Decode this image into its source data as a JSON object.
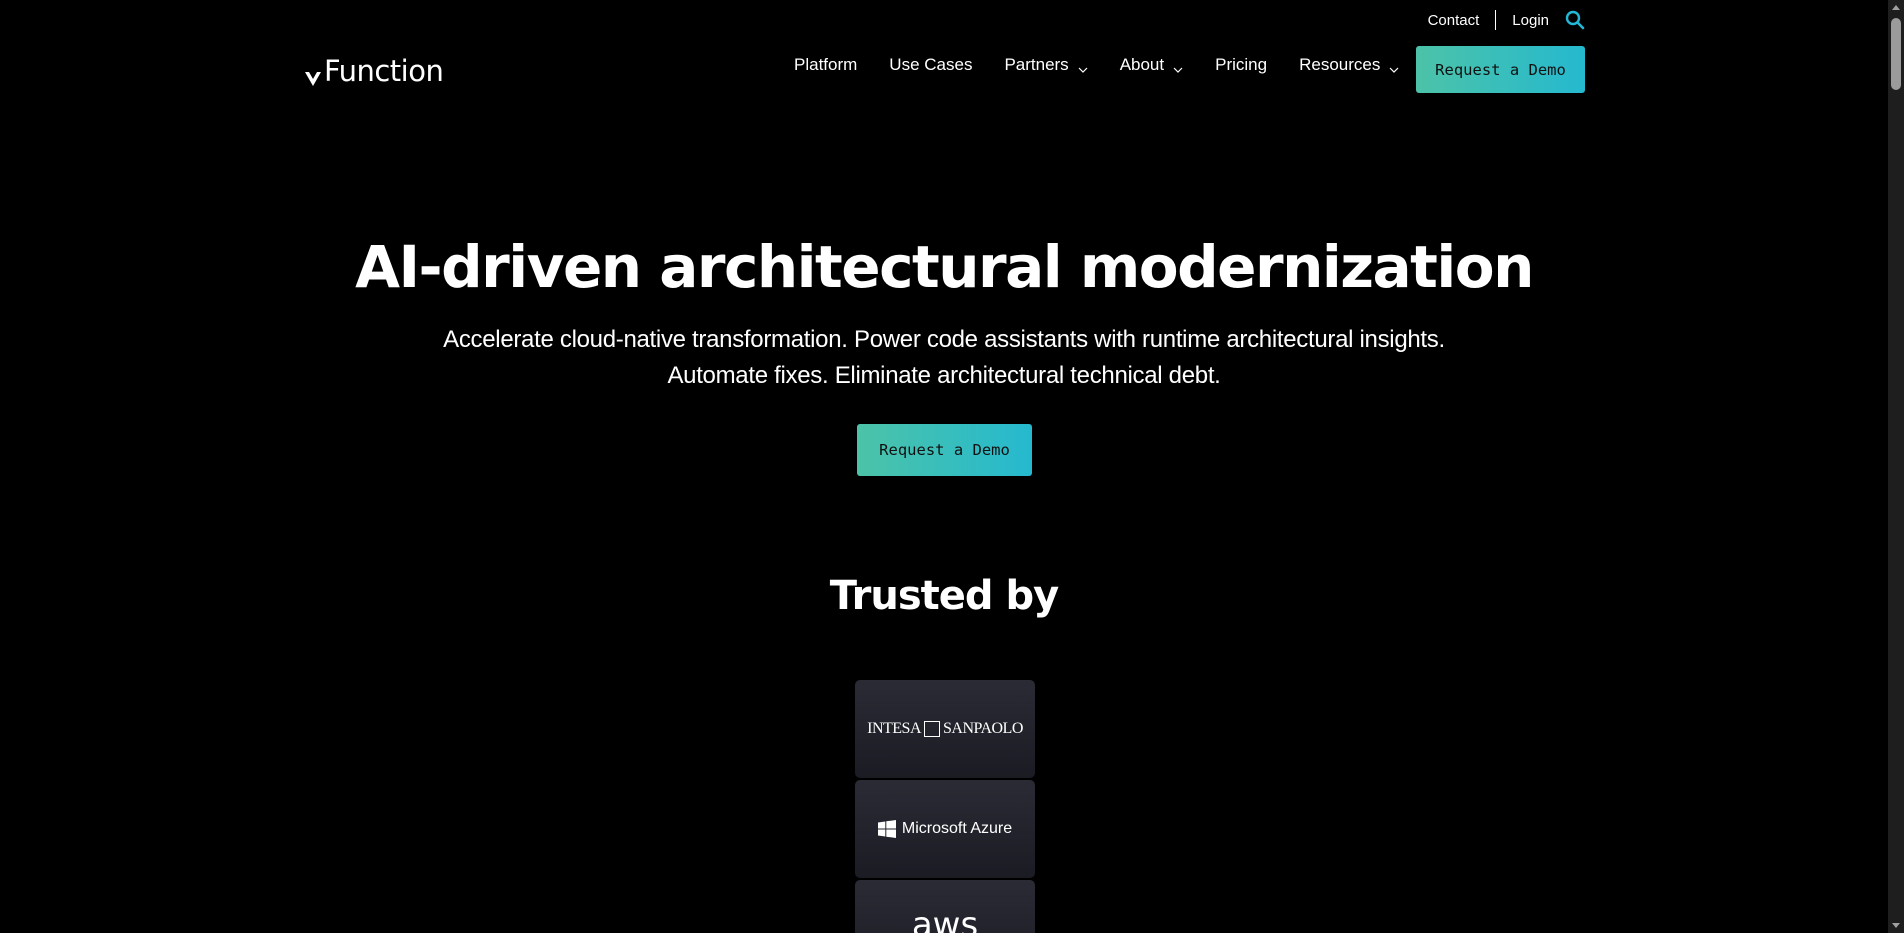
{
  "utility": {
    "contact": "Contact",
    "login": "Login"
  },
  "header": {
    "logo_text": "Function",
    "nav": [
      {
        "label": "Platform"
      },
      {
        "label": "Use Cases"
      },
      {
        "label": "Partners"
      },
      {
        "label": "About"
      },
      {
        "label": "Pricing"
      },
      {
        "label": "Resources"
      }
    ],
    "cta_label": "Request a Demo"
  },
  "hero": {
    "title": "AI-driven architectural modernization",
    "subtitle_line1": "Accelerate cloud-native transformation. Power code assistants with runtime architectural insights.",
    "subtitle_line2": "Automate fixes. Eliminate architectural technical debt.",
    "cta_label": "Request a Demo"
  },
  "trusted": {
    "heading": "Trusted by",
    "logos": [
      {
        "left": "INTESA",
        "right": "SANPAOLO"
      },
      {
        "name": "Microsoft Azure"
      },
      {
        "name": "aws"
      }
    ]
  },
  "colors": {
    "accent_start": "#4cc3a8",
    "accent_end": "#25b9cf",
    "search_icon": "#22b8d6",
    "background": "#000000"
  },
  "icons": {
    "search": "search-icon",
    "chevron": "chevron-down-icon",
    "logo_mark": "vfunction-v-icon",
    "windows": "windows-logo-icon"
  }
}
